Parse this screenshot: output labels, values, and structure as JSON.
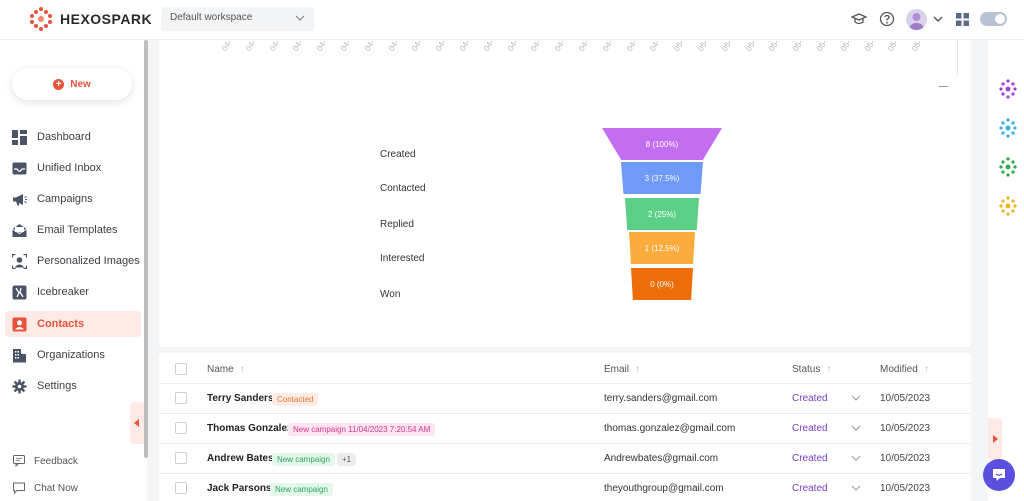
{
  "brand": {
    "name": "HEXOSPARK"
  },
  "header": {
    "workspace": "Default workspace"
  },
  "sidebar": {
    "new_label": "New",
    "items": [
      {
        "label": "Dashboard",
        "icon": "dashboard-icon"
      },
      {
        "label": "Unified Inbox",
        "icon": "inbox-icon"
      },
      {
        "label": "Campaigns",
        "icon": "megaphone-icon"
      },
      {
        "label": "Email Templates",
        "icon": "email-template-icon"
      },
      {
        "label": "Personalized Images",
        "icon": "personalized-images-icon"
      },
      {
        "label": "Icebreaker",
        "icon": "icebreaker-icon"
      },
      {
        "label": "Contacts",
        "icon": "contacts-icon",
        "active": true
      },
      {
        "label": "Organizations",
        "icon": "organizations-icon"
      },
      {
        "label": "Settings",
        "icon": "gear-icon"
      }
    ],
    "footer": [
      {
        "label": "Feedback",
        "icon": "feedback-icon"
      },
      {
        "label": "Chat Now",
        "icon": "chat-icon"
      }
    ]
  },
  "chart_data": {
    "type": "funnel",
    "categories": [
      "Created",
      "Contacted",
      "Replied",
      "Interested",
      "Won"
    ],
    "values": [
      8,
      3,
      2,
      1,
      0
    ],
    "value_labels": [
      "8 (100%)",
      "3 (37.5%)",
      "2 (25%)",
      "1 (12.5%)",
      "0 (0%)"
    ],
    "colors": [
      "#c36ef0",
      "#6f9af7",
      "#5bcf86",
      "#fbac3c",
      "#ed6e09"
    ],
    "date_ticks": [
      "04-",
      "04-",
      "04-",
      "04-",
      "04-",
      "04-",
      "04-",
      "04-",
      "04-",
      "04-",
      "04-",
      "04-",
      "04-",
      "04-",
      "04-",
      "04-",
      "04-",
      "04-",
      "04-",
      "05-",
      "05-",
      "05-",
      "05-",
      "05-",
      "05-",
      "05-",
      "05-",
      "05-",
      "05-",
      "05-"
    ]
  },
  "table": {
    "columns": {
      "name": "Name",
      "email": "Email",
      "status": "Status",
      "modified": "Modified"
    },
    "rows": [
      {
        "name": "Terry Sanders",
        "tag": "Contacted",
        "tag_style": "orange",
        "extra": "",
        "email": "terry.sanders@gmail.com",
        "status": "Created",
        "modified": "10/05/2023"
      },
      {
        "name": "Thomas Gonzalez",
        "tag": "New campaign 11/04/2023 7:20:54 AM",
        "tag_style": "pink",
        "extra": "",
        "email": "thomas.gonzalez@gmail.com",
        "status": "Created",
        "modified": "10/05/2023"
      },
      {
        "name": "Andrew Bates",
        "tag": "New campaign",
        "tag_style": "green",
        "extra": "+1",
        "email": "Andrewbates@gmail.com",
        "status": "Created",
        "modified": "10/05/2023"
      },
      {
        "name": "Jack Parsons",
        "tag": "New campaign",
        "tag_style": "green",
        "extra": "",
        "email": "theyouthgroup@gmail.com",
        "status": "Created",
        "modified": "10/05/2023"
      }
    ]
  },
  "colors": {
    "accent": "#e8533a",
    "status": "#7a3fc9",
    "chat": "#5b4fe0"
  }
}
